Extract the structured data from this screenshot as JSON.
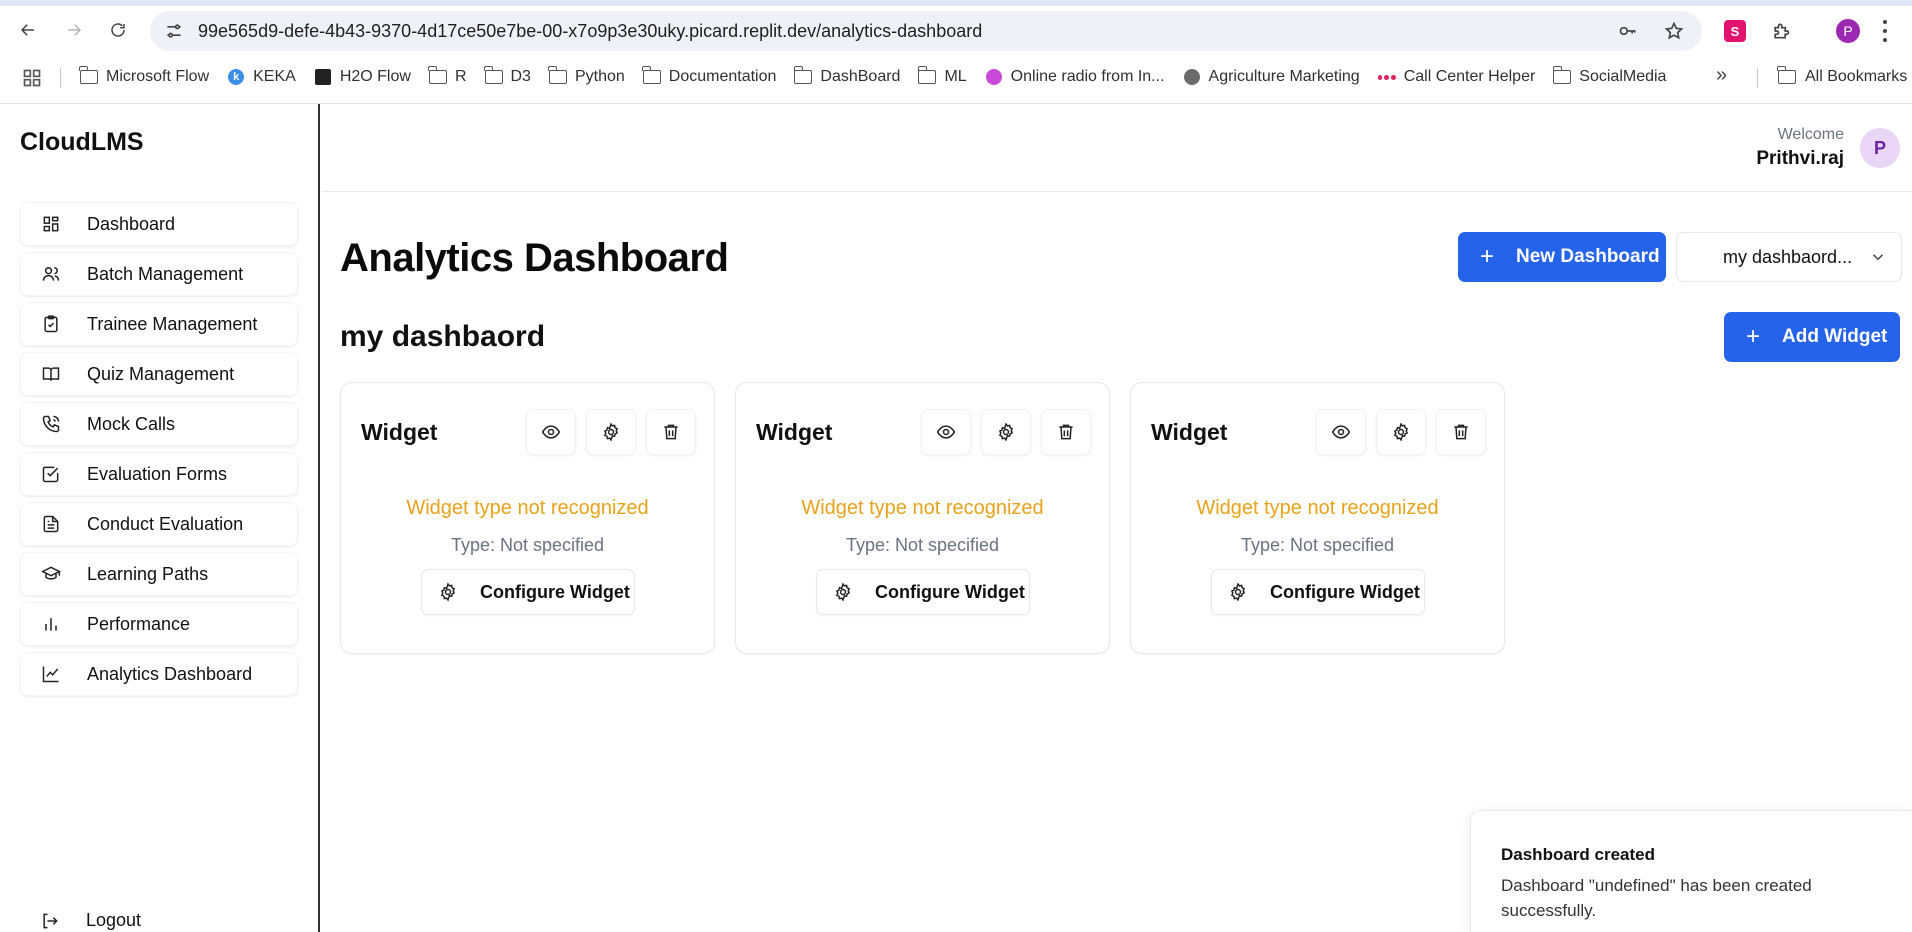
{
  "browser": {
    "url": "99e565d9-defe-4b43-9370-4d17ce50e7be-00-x7o9p3e30uky.picard.replit.dev/analytics-dashboard",
    "profile_initial": "P",
    "bookmarks": [
      {
        "label": "Microsoft Flow",
        "icon": "folder-icon"
      },
      {
        "label": "KEKA",
        "icon": "keka-icon"
      },
      {
        "label": "H2O Flow",
        "icon": "h2o-icon"
      },
      {
        "label": "R",
        "icon": "folder-icon"
      },
      {
        "label": "D3",
        "icon": "folder-icon"
      },
      {
        "label": "Python",
        "icon": "folder-icon"
      },
      {
        "label": "Documentation",
        "icon": "folder-icon"
      },
      {
        "label": "DashBoard",
        "icon": "folder-icon"
      },
      {
        "label": "ML",
        "icon": "folder-icon"
      },
      {
        "label": "Online radio from In...",
        "icon": "radio-icon"
      },
      {
        "label": "Agriculture Marketing",
        "icon": "globe-icon"
      },
      {
        "label": "Call Center Helper",
        "icon": "dots-icon"
      },
      {
        "label": "SocialMedia",
        "icon": "folder-icon"
      }
    ],
    "all_bookmarks": "All Bookmarks"
  },
  "app": {
    "brand": "CloudLMS",
    "nav": [
      {
        "label": "Dashboard",
        "icon": "grid-icon"
      },
      {
        "label": "Batch Management",
        "icon": "users-icon"
      },
      {
        "label": "Trainee Management",
        "icon": "clipboard-check-icon"
      },
      {
        "label": "Quiz Management",
        "icon": "book-open-icon"
      },
      {
        "label": "Mock Calls",
        "icon": "phone-icon"
      },
      {
        "label": "Evaluation Forms",
        "icon": "checkbox-icon"
      },
      {
        "label": "Conduct Evaluation",
        "icon": "file-text-icon"
      },
      {
        "label": "Learning Paths",
        "icon": "graduation-cap-icon"
      },
      {
        "label": "Performance",
        "icon": "bar-chart-icon"
      },
      {
        "label": "Analytics Dashboard",
        "icon": "line-chart-icon"
      }
    ],
    "logout": "Logout",
    "user": {
      "welcome": "Welcome",
      "name": "Prithvi.raj",
      "initial": "P"
    }
  },
  "page": {
    "title": "Analytics Dashboard",
    "new_dashboard": "New Dashboard",
    "dashboard_select": "my dashbaord...",
    "dashboard_name": "my dashbaord",
    "add_widget": "Add Widget",
    "widgets": [
      {
        "title": "Widget",
        "warning": "Widget type not recognized",
        "type": "Type: Not specified",
        "configure": "Configure Widget"
      },
      {
        "title": "Widget",
        "warning": "Widget type not recognized",
        "type": "Type: Not specified",
        "configure": "Configure Widget"
      },
      {
        "title": "Widget",
        "warning": "Widget type not recognized",
        "type": "Type: Not specified",
        "configure": "Configure Widget"
      }
    ]
  },
  "toast": {
    "title": "Dashboard created",
    "message": "Dashboard \"undefined\" has been created successfully."
  },
  "colors": {
    "primary": "#2563eb",
    "warning": "#e8a21b",
    "avatar_bg": "#ead7f8"
  }
}
